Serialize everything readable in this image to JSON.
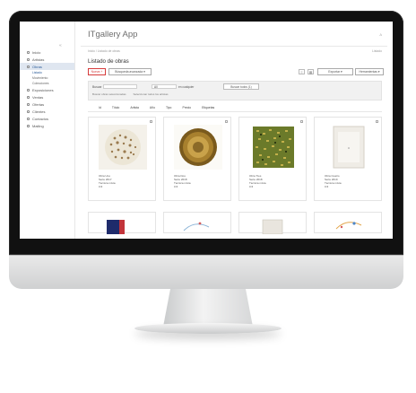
{
  "app": {
    "title": "ITgallery App",
    "user": "A"
  },
  "sidebar": {
    "collapse_glyph": "«",
    "items": [
      {
        "label": "Inicio",
        "icon": "home-icon"
      },
      {
        "label": "Artistas",
        "icon": "user-icon"
      },
      {
        "label": "Obras",
        "icon": "image-icon",
        "active": true,
        "subitems": [
          "Listado",
          "Movimiento",
          "Colecciones"
        ]
      },
      {
        "label": "Exposiciones",
        "icon": "frame-icon"
      },
      {
        "label": "Ventas",
        "icon": "cart-icon"
      },
      {
        "label": "Ofertas",
        "icon": "tag-icon"
      },
      {
        "label": "Clientes",
        "icon": "people-icon"
      },
      {
        "label": "Contactos",
        "icon": "contact-icon"
      },
      {
        "label": "Mailing",
        "icon": "mail-icon"
      }
    ]
  },
  "breadcrumb": "Inicio / Listado de obras",
  "breadcrumb_right": "Listado",
  "page_title": "Listado de obras",
  "toolbar": {
    "new_label": "Nueva +",
    "advanced_label": "Búsqueda avanzada ▾",
    "export_label": "Exportar ▾",
    "tools_label": "Herramientas ▾"
  },
  "search": {
    "label": "Buscar",
    "select_value": "All",
    "match_label": "en cualquier",
    "button_label": "Buscar todos (1)",
    "options": [
      "Buscar obras seleccionadas",
      "Seleccionar todos los artistas"
    ]
  },
  "filters": [
    "Id",
    "Título",
    "Artista",
    "Año",
    "Tipo",
    "Precio",
    "Etiquetas"
  ],
  "cards": [
    {
      "lines": [
        "Obra Uno",
        "Serie 2017",
        "Técnica mixta",
        "0 €"
      ],
      "art": "dots"
    },
    {
      "lines": [
        "Obra Dos",
        "Serie 2018",
        "Técnica mixta",
        "0 €"
      ],
      "art": "sphere"
    },
    {
      "lines": [
        "Obra Tres",
        "Serie 2018",
        "Técnica mixta",
        "0 €"
      ],
      "art": "grain"
    },
    {
      "lines": [
        "Obra Cuatro",
        "Serie 2019",
        "Técnica mixta",
        "0 €"
      ],
      "art": "frame"
    }
  ],
  "colors": {
    "accent": "#d63b3b",
    "active_bg": "#dfe6f0"
  }
}
